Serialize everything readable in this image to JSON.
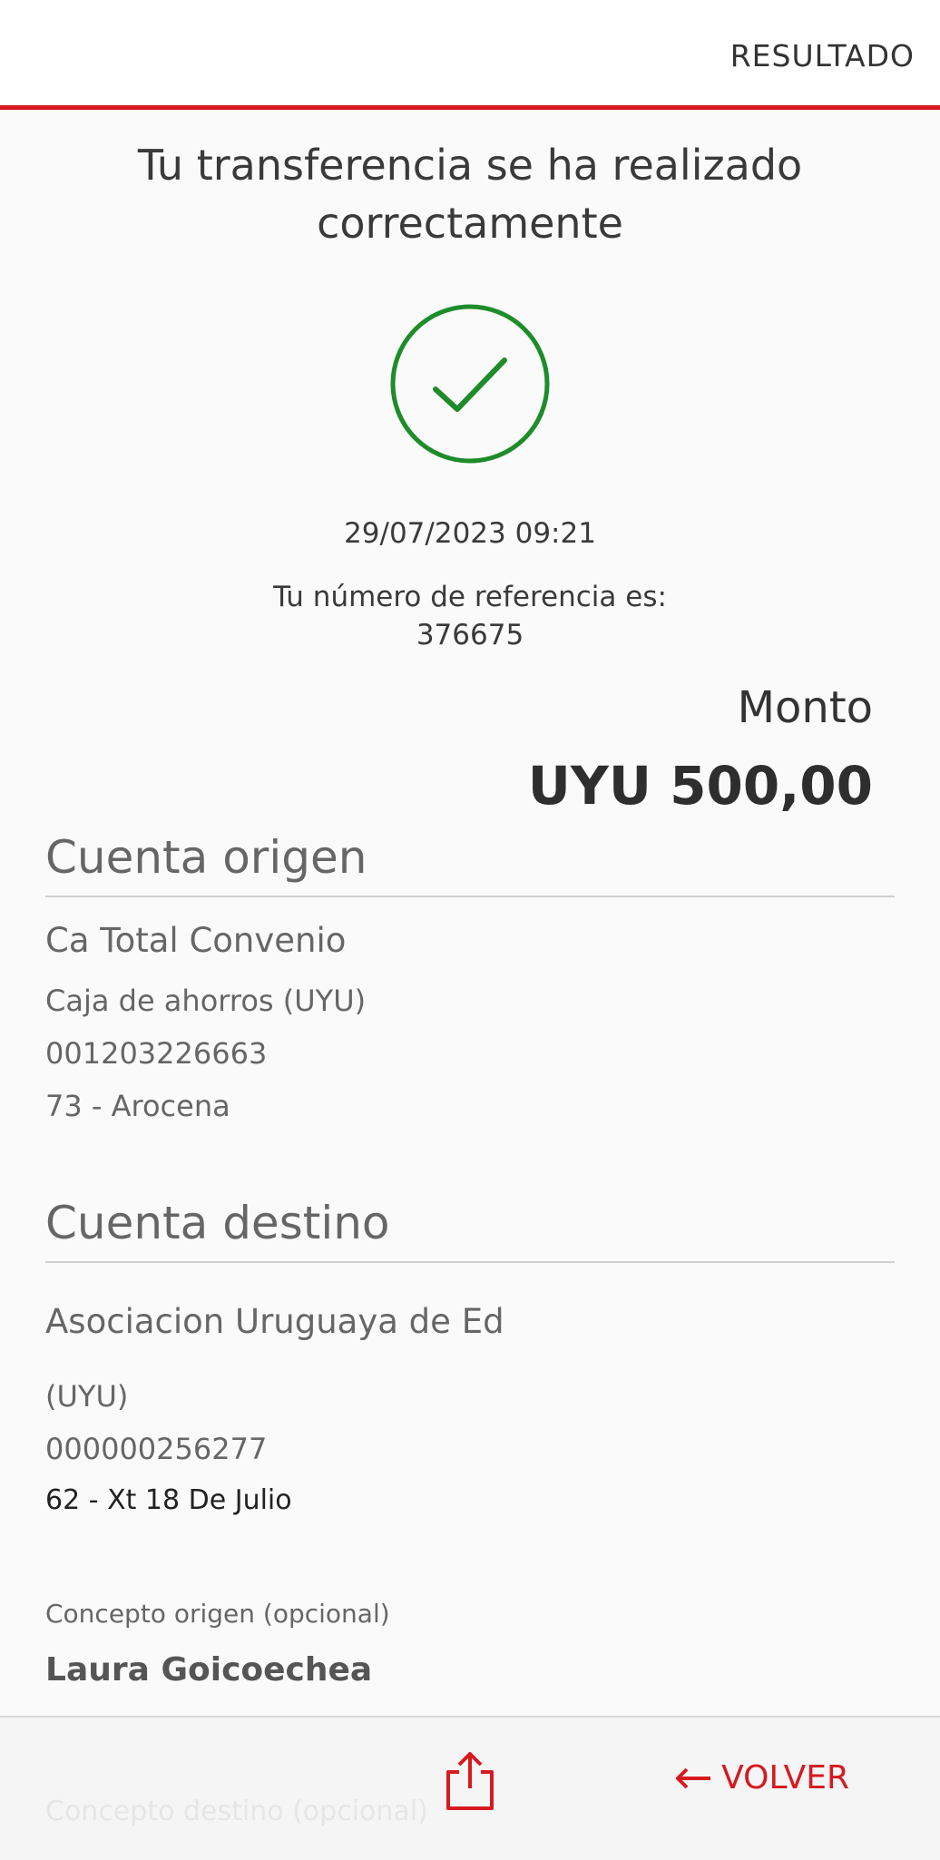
{
  "header": {
    "title": "RESULTADO"
  },
  "result": {
    "title_line1": "Tu transferencia se ha realizado",
    "title_line2": "correctamente",
    "datetime": "29/07/2023 09:21",
    "reference_label": "Tu número de referencia es:",
    "reference_number": "376675"
  },
  "amount": {
    "label": "Monto",
    "value": "UYU 500,00"
  },
  "origin": {
    "title": "Cuenta origen",
    "name": "Ca Total Convenio",
    "type": "Caja de ahorros (UYU)",
    "number": "001203226663",
    "branch": "73 - Arocena"
  },
  "destination": {
    "title": "Cuenta destino",
    "name": "Asociacion Uruguaya de Ed",
    "type": "(UYU)",
    "number": "000000256277",
    "branch": "62 - Xt 18 De Julio"
  },
  "concept": {
    "label": "Concepto origen (opcional)",
    "value": "Laura Goicoechea"
  },
  "footer": {
    "ghost_text": "Concepto destino (opcional)",
    "back_label": "VOLVER",
    "share_icon": "share-icon",
    "back_icon": "arrow-left-icon"
  },
  "colors": {
    "accent": "#d71920",
    "success": "#1e8c2a"
  }
}
